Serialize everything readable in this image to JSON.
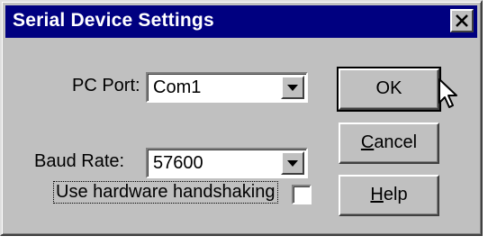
{
  "window": {
    "title": "Serial Device Settings"
  },
  "form": {
    "pc_port_label": "PC Port:",
    "pc_port_value": "Com1",
    "baud_rate_label": "Baud Rate:",
    "baud_rate_value": "57600",
    "handshaking_label": "Use hardware handshaking",
    "handshaking_checked": false
  },
  "buttons": {
    "ok_label": "OK",
    "cancel_mnemonic": "C",
    "cancel_rest": "ancel",
    "help_mnemonic": "H",
    "help_rest": "elp"
  },
  "icons": {
    "close": "close-icon",
    "dropdown": "chevron-down-icon",
    "cursor": "mouse-pointer-icon"
  },
  "colors": {
    "titlebar": "#000080",
    "face": "#c0c0c0"
  }
}
